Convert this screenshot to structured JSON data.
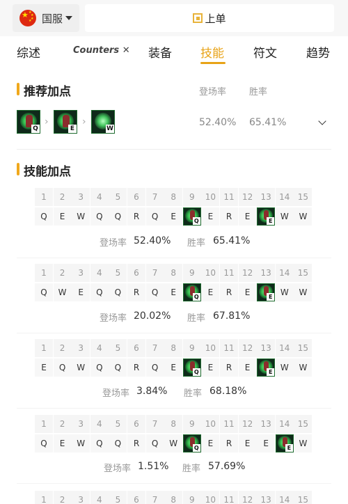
{
  "header": {
    "region_label": "国服",
    "lane_label": "上单"
  },
  "tabs": [
    {
      "label": "综述"
    },
    {
      "label": "Counters"
    },
    {
      "label": "装备"
    },
    {
      "label": "技能"
    },
    {
      "label": "符文"
    },
    {
      "label": "趋势"
    }
  ],
  "active_tab": "技能",
  "recommended": {
    "title": "推荐加点",
    "col_pick": "登场率",
    "col_win": "胜率",
    "sequence": [
      "Q",
      "E",
      "W"
    ],
    "pick_rate": "52.40%",
    "win_rate": "65.41%"
  },
  "skill_order": {
    "title": "技能加点",
    "pick_label": "登场率",
    "win_label": "胜率",
    "levels": [
      "1",
      "2",
      "3",
      "4",
      "5",
      "6",
      "7",
      "8",
      "9",
      "10",
      "11",
      "12",
      "13",
      "14",
      "15"
    ],
    "builds": [
      {
        "keys": [
          "Q",
          "E",
          "W",
          "Q",
          "Q",
          "R",
          "Q",
          "E",
          "Q",
          "E",
          "R",
          "E",
          "E",
          "W",
          "W"
        ],
        "pick_rate": "52.40%",
        "win_rate": "65.41%"
      },
      {
        "keys": [
          "Q",
          "W",
          "E",
          "Q",
          "Q",
          "R",
          "Q",
          "E",
          "Q",
          "E",
          "R",
          "E",
          "E",
          "W",
          "W"
        ],
        "pick_rate": "20.02%",
        "win_rate": "67.81%"
      },
      {
        "keys": [
          "E",
          "Q",
          "W",
          "Q",
          "Q",
          "R",
          "Q",
          "E",
          "Q",
          "E",
          "R",
          "E",
          "E",
          "W",
          "W"
        ],
        "pick_rate": "3.84%",
        "win_rate": "68.18%"
      },
      {
        "keys": [
          "Q",
          "E",
          "W",
          "Q",
          "Q",
          "R",
          "Q",
          "W",
          "Q",
          "E",
          "R",
          "E",
          "E",
          "E",
          "W"
        ],
        "pick_rate": "1.51%",
        "win_rate": "57.69%"
      },
      {
        "keys": [
          "",
          "",
          "",
          "",
          "",
          "",
          "",
          "",
          "",
          "",
          "",
          "",
          "",
          "",
          ""
        ],
        "pick_rate": "",
        "win_rate": ""
      }
    ]
  },
  "colors": {
    "accent": "#e8a317",
    "section_bar": "#f0a81c"
  },
  "icons": {
    "skill": "champion-ability-icon",
    "lane": "top-lane-icon"
  }
}
